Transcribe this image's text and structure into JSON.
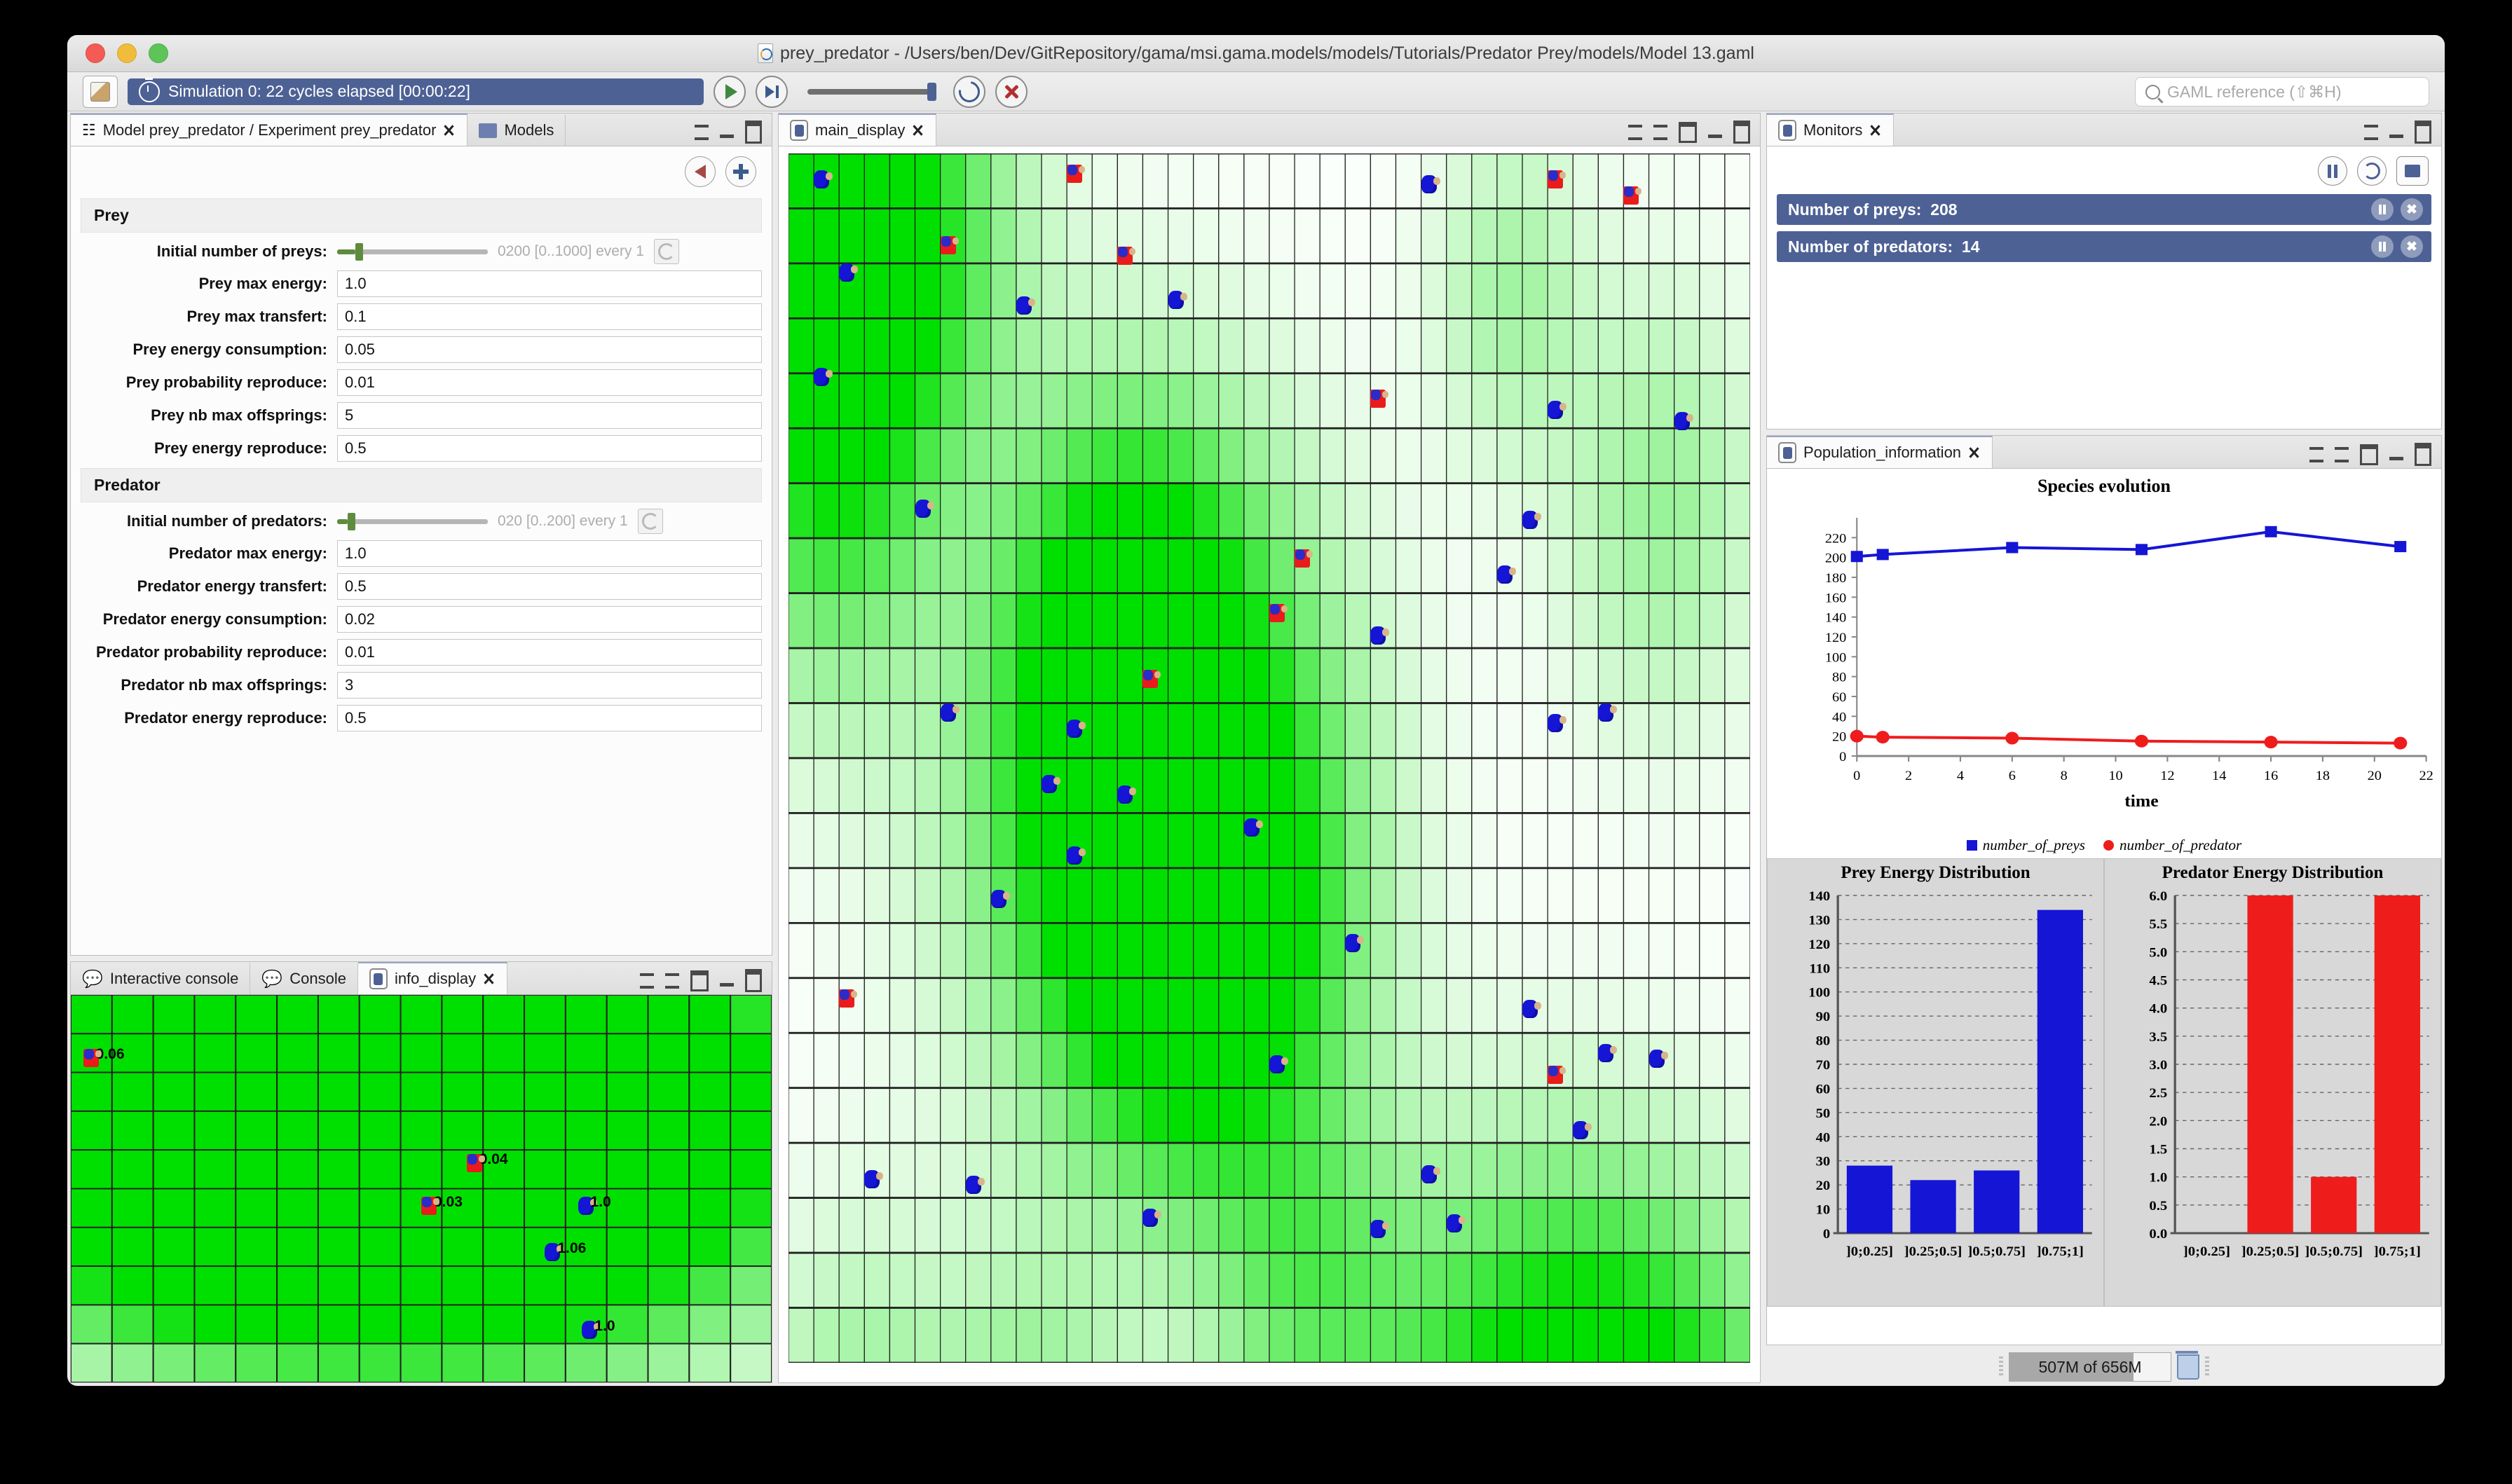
{
  "window": {
    "title": "prey_predator - /Users/ben/Dev/GitRepository/gama/msi.gama.models/models/Tutorials/Predator Prey/models/Model 13.gaml"
  },
  "toolbar": {
    "status": "Simulation 0: 22 cycles elapsed [00:00:22]",
    "search_placeholder": "GAML reference (⇧⌘H)",
    "play_label": "play-button",
    "step_label": "step-button",
    "reload_label": "reload-button",
    "close_label": "close-button"
  },
  "left_panel": {
    "tabs": [
      {
        "label": "Model prey_predator / Experiment prey_predator",
        "active": true
      },
      {
        "label": "Models",
        "active": false
      }
    ],
    "sections": [
      {
        "title": "Prey",
        "params": [
          {
            "label": "Initial number of preys:",
            "type": "slider",
            "range": "0200 [0..1000] every 1",
            "fill": 12,
            "knob": 12
          },
          {
            "label": "Prey max energy:",
            "type": "text",
            "value": "1.0"
          },
          {
            "label": "Prey max transfert:",
            "type": "text",
            "value": "0.1"
          },
          {
            "label": "Prey energy consumption:",
            "type": "text",
            "value": "0.05"
          },
          {
            "label": "Prey probability reproduce:",
            "type": "text",
            "value": "0.01"
          },
          {
            "label": "Prey nb max offsprings:",
            "type": "text",
            "value": "5"
          },
          {
            "label": "Prey energy reproduce:",
            "type": "text",
            "value": "0.5"
          }
        ]
      },
      {
        "title": "Predator",
        "params": [
          {
            "label": "Initial number of predators:",
            "type": "slider",
            "range": "020 [0..200] every 1",
            "fill": 7,
            "knob": 7
          },
          {
            "label": "Predator max energy:",
            "type": "text",
            "value": "1.0"
          },
          {
            "label": "Predator energy transfert:",
            "type": "text",
            "value": "0.5"
          },
          {
            "label": "Predator energy consumption:",
            "type": "text",
            "value": "0.02"
          },
          {
            "label": "Predator probability reproduce:",
            "type": "text",
            "value": "0.01"
          },
          {
            "label": "Predator nb max offsprings:",
            "type": "text",
            "value": "3"
          },
          {
            "label": "Predator energy reproduce:",
            "type": "text",
            "value": "0.5"
          }
        ]
      }
    ]
  },
  "console_panel": {
    "tabs": [
      {
        "label": "Interactive console",
        "active": false
      },
      {
        "label": "Console",
        "active": false
      },
      {
        "label": "info_display",
        "active": true
      }
    ],
    "agent_labels": [
      "0.06",
      "0.04",
      "0.03",
      "1.0",
      "1.06",
      "1.0"
    ]
  },
  "main_display": {
    "tab_label": "main_display"
  },
  "monitors": {
    "tab_label": "Monitors",
    "rows": [
      {
        "label": "Number of preys:",
        "value": "208"
      },
      {
        "label": "Number of predators:",
        "value": "14"
      }
    ]
  },
  "population": {
    "tab_label": "Population_information"
  },
  "status": {
    "memory": "507M of 656M",
    "memory_percent": 77
  },
  "colors": {
    "prey": "#1515d6",
    "predator": "#ef1c1c",
    "accent": "#4d6195",
    "grass": "#00e000"
  },
  "chart_data": [
    {
      "type": "line",
      "title": "Species evolution",
      "xlabel": "time",
      "ylabel": "",
      "xlim": [
        0,
        22
      ],
      "ylim": [
        0,
        240
      ],
      "xticks": [
        0,
        2,
        4,
        6,
        8,
        10,
        12,
        14,
        16,
        18,
        20,
        22
      ],
      "yticks": [
        0,
        20,
        40,
        60,
        80,
        100,
        120,
        140,
        160,
        180,
        200,
        220
      ],
      "grid": false,
      "legend_position": "bottom",
      "x": [
        0,
        1,
        6,
        11,
        16,
        21
      ],
      "series": [
        {
          "name": "number_of_preys",
          "color": "#1515d6",
          "marker": "square",
          "values": [
            201,
            203,
            210,
            208,
            226,
            211
          ]
        },
        {
          "name": "number_of_predator",
          "color": "#ef1c1c",
          "marker": "circle",
          "values": [
            20,
            19,
            18,
            15,
            14,
            13
          ]
        }
      ]
    },
    {
      "type": "bar",
      "title": "Prey Energy Distribution",
      "categories": [
        "]0;0.25]",
        "]0.25;0.5]",
        "]0.5;0.75]",
        "]0.75;1]"
      ],
      "values": [
        28,
        22,
        26,
        134
      ],
      "color": "#1515d6",
      "ylim": [
        0,
        140
      ],
      "yticks": [
        0,
        10,
        20,
        30,
        40,
        50,
        60,
        70,
        80,
        90,
        100,
        110,
        120,
        130,
        140
      ],
      "xlabel": "",
      "ylabel": "",
      "grid": true
    },
    {
      "type": "bar",
      "title": "Predator Energy Distribution",
      "categories": [
        "]0;0.25]",
        "]0.25;0.5]",
        "]0.5;0.75]",
        "]0.75;1]"
      ],
      "values": [
        0,
        6,
        1,
        6
      ],
      "color": "#ef1c1c",
      "ylim": [
        0,
        6
      ],
      "yticks": [
        0.0,
        0.5,
        1.0,
        1.5,
        2.0,
        2.5,
        3.0,
        3.5,
        4.0,
        4.5,
        5.0,
        5.5,
        6.0
      ],
      "xlabel": "",
      "ylabel": "",
      "grid": true
    }
  ]
}
